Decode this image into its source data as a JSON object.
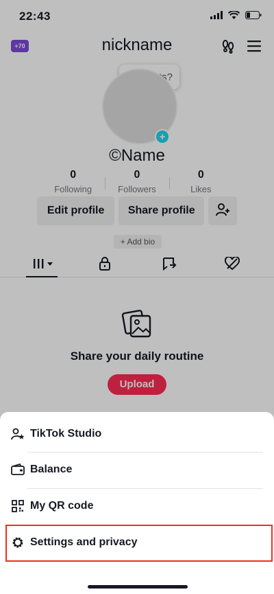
{
  "status_bar": {
    "time": "22:43"
  },
  "header": {
    "coin_badge": "+70",
    "nickname": "nickname"
  },
  "tooltip": {
    "text": "ts?"
  },
  "profile": {
    "username": "©Name"
  },
  "stats": [
    {
      "value": "0",
      "label": "Following"
    },
    {
      "value": "0",
      "label": "Followers"
    },
    {
      "value": "0",
      "label": "Likes"
    }
  ],
  "buttons": {
    "edit_profile": "Edit profile",
    "share_profile": "Share profile"
  },
  "add_bio": "+ Add bio",
  "empty_state": {
    "title": "Share your daily routine",
    "upload": "Upload"
  },
  "sheet": {
    "items": [
      {
        "label": "TikTok Studio",
        "icon": "person-star-icon"
      },
      {
        "label": "Balance",
        "icon": "wallet-icon"
      },
      {
        "label": "My QR code",
        "icon": "qr-code-icon"
      },
      {
        "label": "Settings and privacy",
        "icon": "gear-icon"
      }
    ]
  },
  "colors": {
    "accent": "#fe2c55",
    "highlight": "#e8321e",
    "badge": "#7b4bd6",
    "plus": "#20d5ec"
  }
}
